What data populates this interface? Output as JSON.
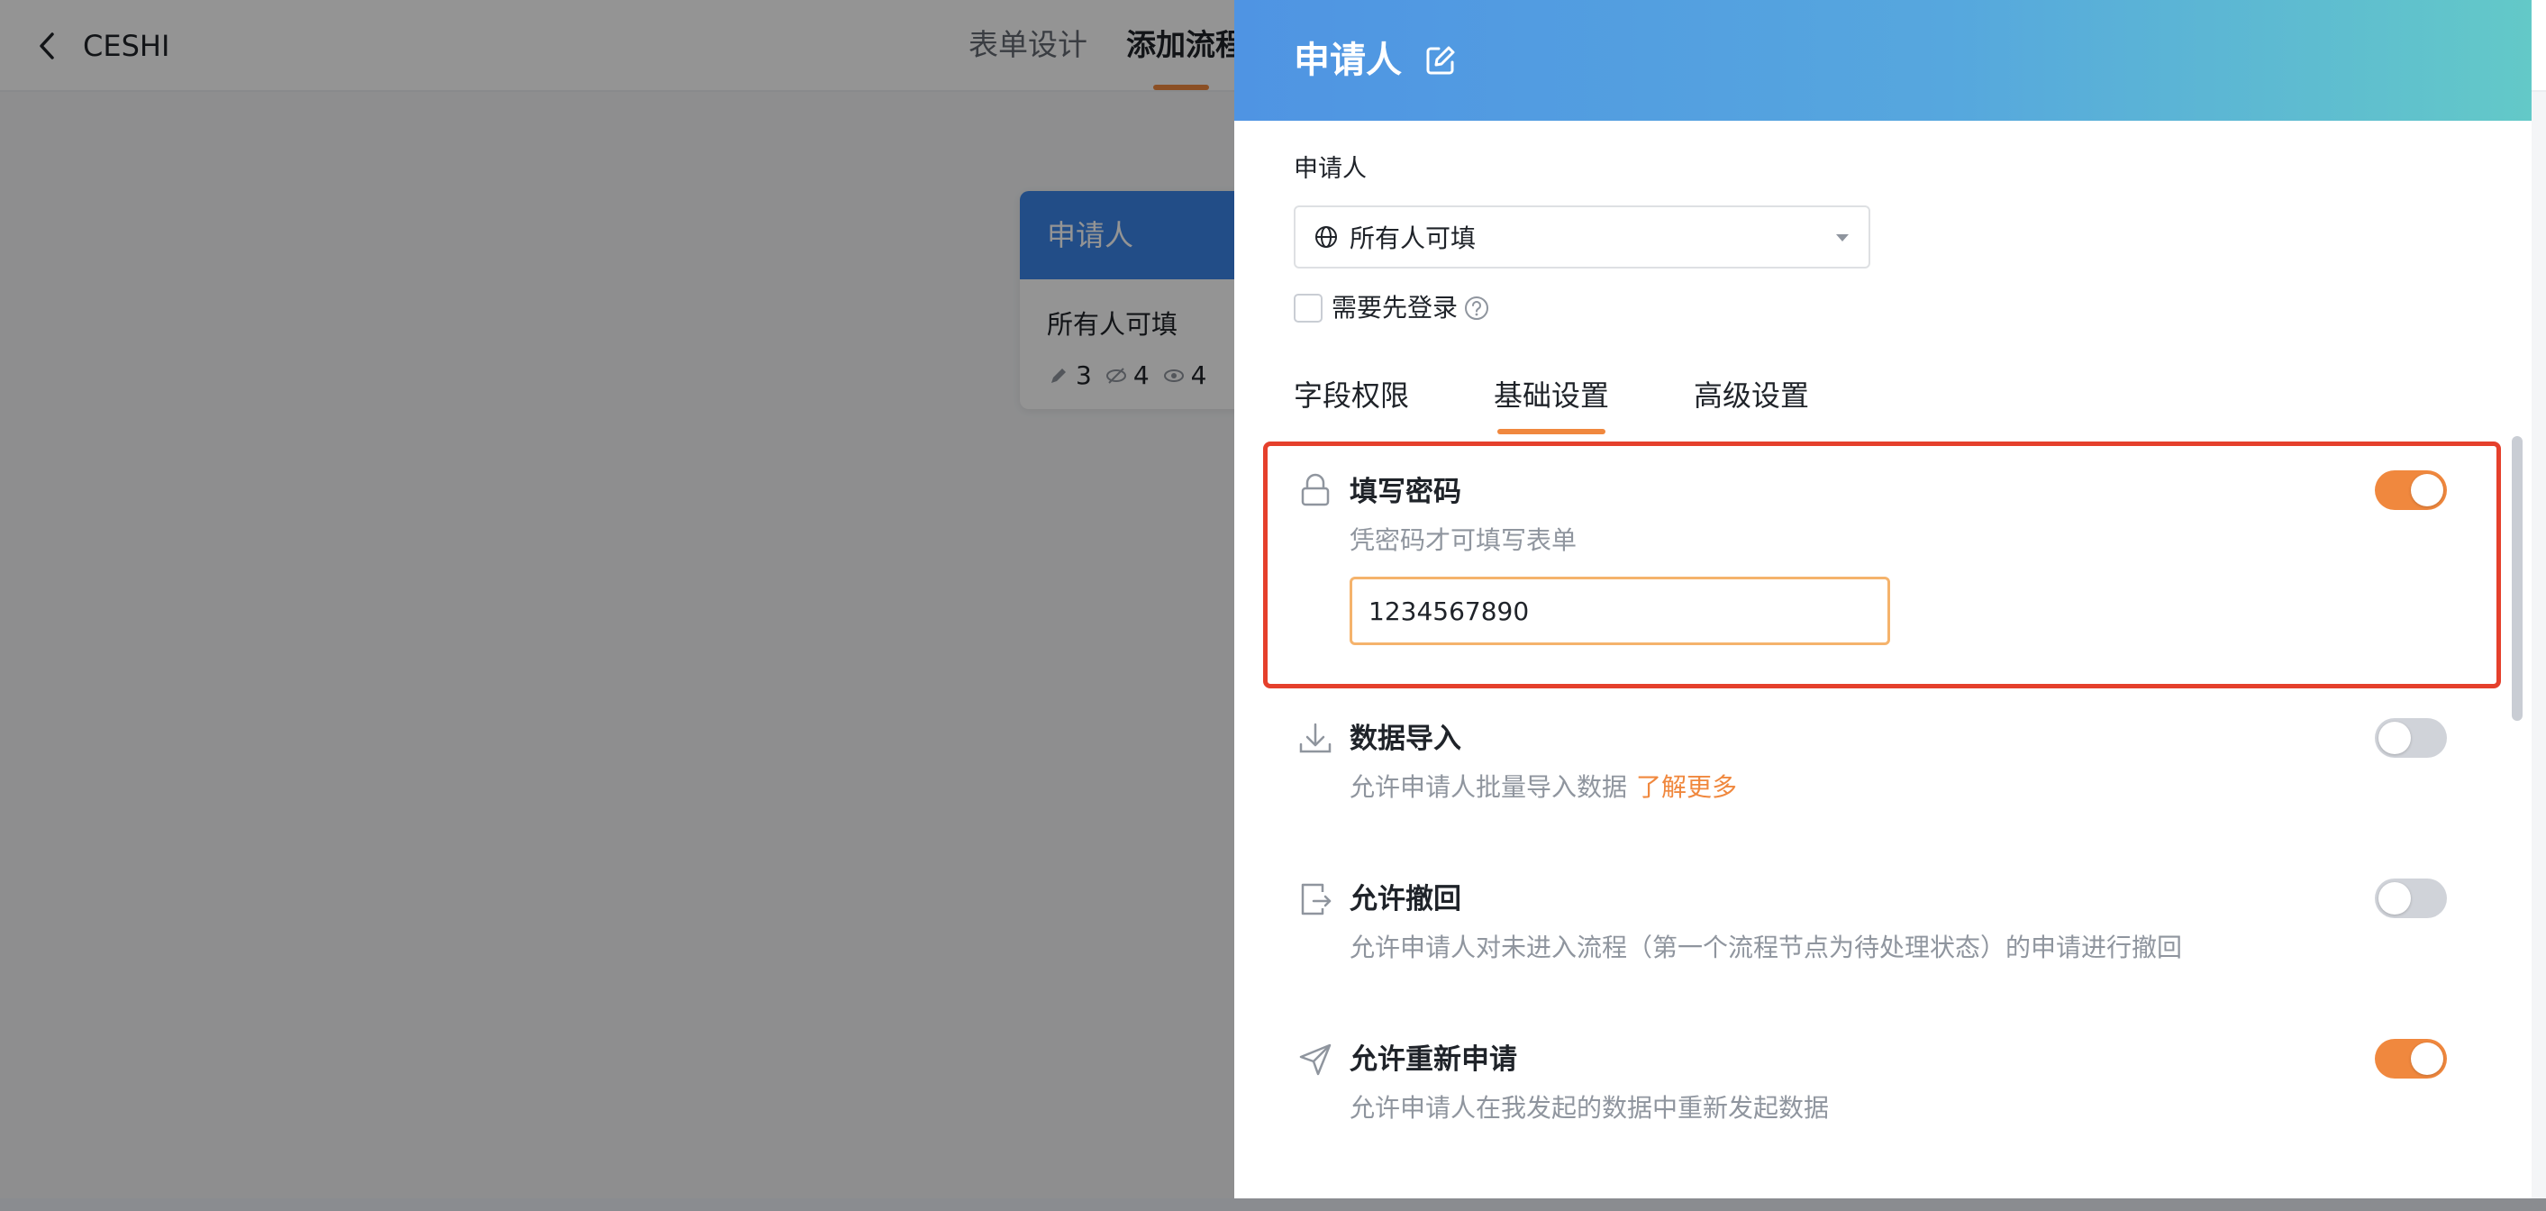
{
  "app": {
    "back_label": "",
    "title": "CESHI",
    "tabs": [
      {
        "label": "表单设计"
      },
      {
        "label": "添加流程"
      }
    ]
  },
  "flow_node": {
    "header": "申请人",
    "body": "所有人可填",
    "stats": {
      "edit": "3",
      "hidden": "4",
      "visible": "4"
    }
  },
  "drawer": {
    "title": "申请人",
    "field_label": "申请人",
    "select_value": "所有人可填",
    "login_required_label": "需要先登录",
    "login_required_checked": false,
    "sub_tabs": [
      {
        "label": "字段权限"
      },
      {
        "label": "基础设置"
      },
      {
        "label": "高级设置"
      }
    ],
    "active_sub_tab": "基础设置",
    "settings": [
      {
        "title": "填写密码",
        "desc": "凭密码才可填写表单",
        "enabled": true,
        "icon": "lock-icon"
      },
      {
        "title": "数据导入",
        "desc": "允许申请人批量导入数据",
        "link": "了解更多",
        "enabled": false,
        "icon": "download-icon"
      },
      {
        "title": "允许撤回",
        "desc": "允许申请人对未进入流程（第一个流程节点为待处理状态）的申请进行撤回",
        "enabled": false,
        "icon": "withdraw-icon"
      },
      {
        "title": "允许重新申请",
        "desc": "允许申请人在我发起的数据中重新发起数据",
        "enabled": true,
        "icon": "send-icon"
      }
    ],
    "password_value": "1234567890"
  },
  "colors": {
    "accent": "#f0883e",
    "highlight": "#e5402c",
    "header_gradient_start": "#4f94e3",
    "header_gradient_end": "#63c9c8",
    "node_header": "#3b86e8"
  }
}
